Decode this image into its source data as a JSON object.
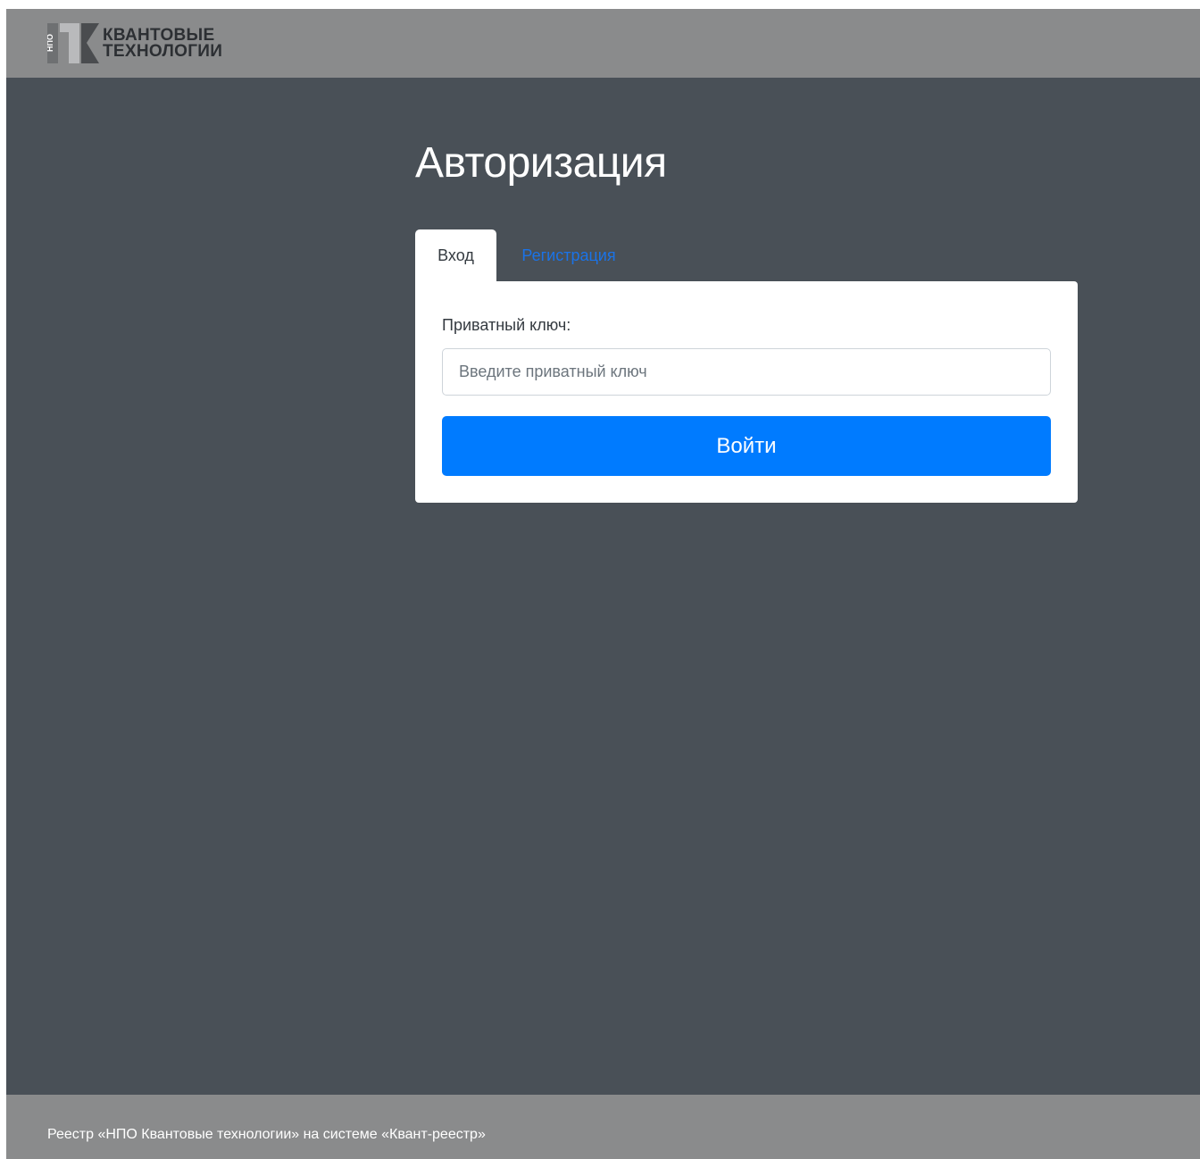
{
  "header": {
    "logo": {
      "side_text": "НПО",
      "line1": "КВАНТОВЫЕ",
      "line2": "ТЕХНОЛОГИИ"
    }
  },
  "main": {
    "title": "Авторизация",
    "tabs": [
      {
        "label": "Вход",
        "active": true
      },
      {
        "label": "Регистрация",
        "active": false
      }
    ],
    "form": {
      "private_key_label": "Приватный ключ:",
      "private_key_value": "",
      "private_key_placeholder": "Введите приватный ключ",
      "submit_label": "Войти"
    }
  },
  "footer": {
    "text": "Реестр «НПО Квантовые технологии» на системе «Квант-реестр»"
  },
  "colors": {
    "header_bg": "#8a8b8c",
    "page_bg": "#495057",
    "primary": "#007bff",
    "link": "#1a73e8"
  }
}
